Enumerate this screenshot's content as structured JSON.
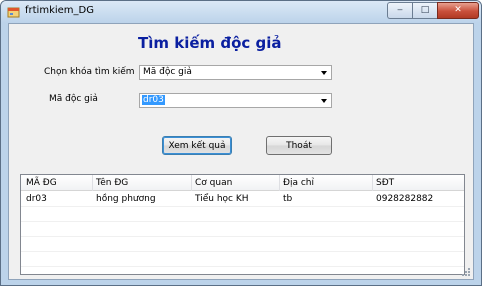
{
  "window": {
    "title": "frtimkiem_DG",
    "controls": {
      "minimize": "‒",
      "maximize": "□",
      "close": "✕"
    },
    "icon": "app-form-icon"
  },
  "form": {
    "heading": "Tìm kiếm độc giả",
    "search_key_label": "Chọn khóa tìm kiếm",
    "search_key_value": "Mã độc giả",
    "reader_id_label": "Mã độc giả",
    "reader_id_value": "dr03",
    "show_button": "Xem kết quả",
    "exit_button": "Thoát"
  },
  "grid": {
    "columns": [
      "MÃ ĐG",
      "Tên ĐG",
      "Cơ quan",
      "Địa chỉ",
      "SĐT"
    ],
    "rows": [
      [
        "dr03",
        "hồng phương",
        "Tiểu học KH",
        "tb",
        "0928282882"
      ]
    ]
  },
  "colors": {
    "heading": "#0a1fa0",
    "selection": "#3399ff",
    "close_button": "#c9503b",
    "frame": "#bcd3ea"
  }
}
